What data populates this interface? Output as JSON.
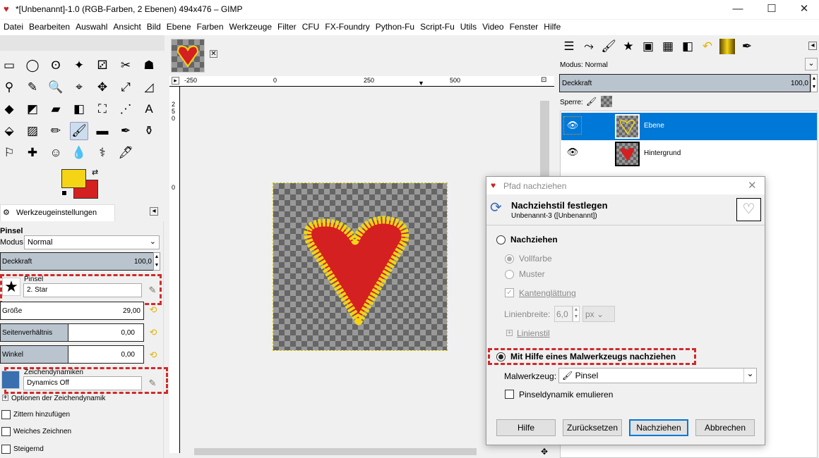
{
  "window": {
    "title": "*[Unbenannt]-1.0 (RGB-Farben, 2 Ebenen) 494x476 – GIMP",
    "minimize": "—",
    "maximize": "☐",
    "close": "✕"
  },
  "menu": [
    "Datei",
    "Bearbeiten",
    "Auswahl",
    "Ansicht",
    "Bild",
    "Ebene",
    "Farben",
    "Werkzeuge",
    "Filter",
    "CFU",
    "FX-Foundry",
    "Python-Fu",
    "Script-Fu",
    "Utils",
    "Video",
    "Fenster",
    "Hilfe"
  ],
  "toolbox": {
    "rows": [
      [
        "▭",
        "◯",
        "ʘ",
        "✦",
        "⚂",
        "✂",
        "☗"
      ],
      [
        "⚲",
        "✎",
        "🔍",
        "⌖",
        "✥",
        "⤢",
        "◿"
      ],
      [
        "◆",
        "◩",
        "▰",
        "◧",
        "⛶",
        "⋰",
        "A"
      ],
      [
        "⬙",
        "▨",
        "✏",
        "🖌",
        "▬",
        "✒",
        "⚱"
      ],
      [
        "⚐",
        "✚",
        "☺",
        "💧",
        "⚕",
        "🖋"
      ]
    ],
    "selected": "3-3"
  },
  "colors": {
    "foreground": "#f5d415",
    "background": "#d42020"
  },
  "tool_options": {
    "tab_label": "Werkzeugeinstellungen",
    "tool_name": "Pinsel",
    "mode_label": "Modus:",
    "mode_value": "Normal",
    "opacity_label": "Deckkraft",
    "opacity_value": "100,0",
    "brush_label": "Pinsel",
    "brush_value": "2. Star",
    "size_label": "Größe",
    "size_value": "29,00",
    "aspect_label": "Seitenverhältnis",
    "aspect_value": "0,00",
    "angle_label": "Winkel",
    "angle_value": "0,00",
    "dynamics_label": "Zeichendynamiken",
    "dynamics_value": "Dynamics Off",
    "dynamics_options": "Optionen der Zeichendynamik",
    "jitter": "Zittern hinzufügen",
    "smooth": "Weiches Zeichnen",
    "incremental": "Steigernd"
  },
  "canvas": {
    "ruler_h": [
      "-250",
      "0",
      "250",
      "500"
    ],
    "ruler_v": [
      "2",
      "5",
      "0",
      "0"
    ],
    "image_tab_close": "✕"
  },
  "layers_panel": {
    "mode_label": "Modus:",
    "mode_value": "Normal",
    "opacity_label": "Deckkraft",
    "opacity_value": "100,0",
    "lock_label": "Sperre:",
    "layers": [
      {
        "name": "Ebene",
        "selected": true
      },
      {
        "name": "Hintergrund",
        "selected": false
      }
    ]
  },
  "dialog": {
    "title": "Pfad nachziehen",
    "heading": "Nachziehstil festlegen",
    "subtitle": "Unbenannt-3 ([Unbenannt])",
    "stroke_line": "Nachziehen",
    "solid": "Vollfarbe",
    "pattern": "Muster",
    "antialias": "Kantenglättung",
    "line_width_label": "Linienbreite:",
    "line_width_value": "6,0",
    "unit": "px",
    "line_style": "Linienstil",
    "paint_tool_option": "Mit Hilfe eines Malwerkzeugs nachziehen",
    "paint_tool_label": "Malwerkzeug:",
    "paint_tool_value": "Pinsel",
    "emulate": "Pinseldynamik emulieren",
    "buttons": {
      "help": "Hilfe",
      "reset": "Zurücksetzen",
      "stroke": "Nachziehen",
      "cancel": "Abbrechen"
    }
  }
}
